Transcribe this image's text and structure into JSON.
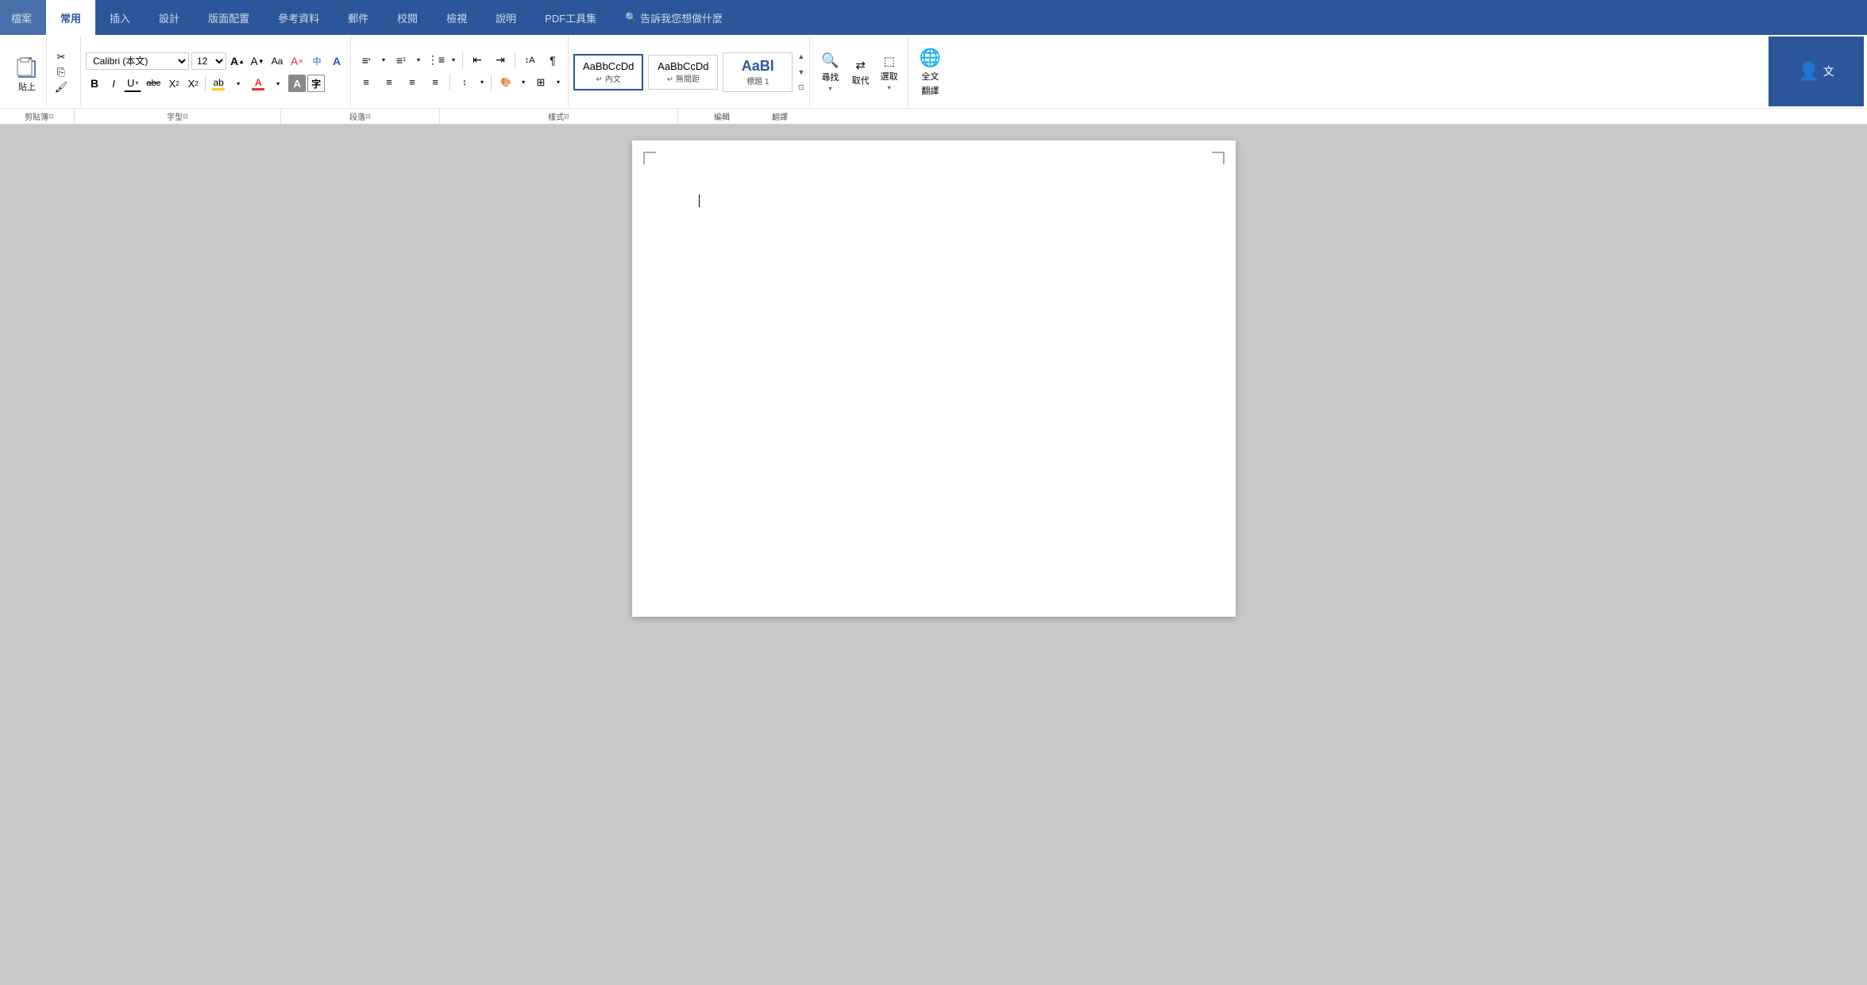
{
  "tabs": [
    {
      "id": "file",
      "label": "檔案",
      "active": false
    },
    {
      "id": "home",
      "label": "常用",
      "active": true
    },
    {
      "id": "insert",
      "label": "插入",
      "active": false
    },
    {
      "id": "design",
      "label": "設計",
      "active": false
    },
    {
      "id": "layout",
      "label": "版面配置",
      "active": false
    },
    {
      "id": "references",
      "label": "參考資料",
      "active": false
    },
    {
      "id": "mailings",
      "label": "郵件",
      "active": false
    },
    {
      "id": "review",
      "label": "校閱",
      "active": false
    },
    {
      "id": "view",
      "label": "檢視",
      "active": false
    },
    {
      "id": "help",
      "label": "說明",
      "active": false
    },
    {
      "id": "pdf",
      "label": "PDF工具集",
      "active": false
    },
    {
      "id": "search",
      "label": "告訴我您想做什麼",
      "active": false
    }
  ],
  "clipboard": {
    "paste": "貼上",
    "cut": "剪下",
    "copy": "複製",
    "format_painter": "複製格式",
    "label": "剪貼簿"
  },
  "font": {
    "name": "Calibri (本文)",
    "size": "12",
    "label": "字型",
    "grow": "增大字型",
    "shrink": "縮小字型",
    "clear": "清除格式",
    "phonetic": "注音指南",
    "bold": "B",
    "italic": "I",
    "underline": "U",
    "strikethrough": "abc",
    "subscript": "X₂",
    "superscript": "X²",
    "text_color": "A",
    "highlight": "ab",
    "font_color_label": "A",
    "change_case": "Aa"
  },
  "paragraph": {
    "label": "段落",
    "bullets": "項目符號",
    "numbering": "編號",
    "multilevel": "多層次清單",
    "decrease_indent": "減少縮排",
    "increase_indent": "增加縮排",
    "sort": "排序",
    "show_marks": "顯示/隱藏編輯標記",
    "align_left": "靠左對齊",
    "center": "置中",
    "align_right": "靠右對齊",
    "justify": "左右對齊",
    "line_spacing": "行距",
    "shading": "網底",
    "borders": "框線"
  },
  "styles": {
    "label": "樣式",
    "items": [
      {
        "id": "normal",
        "text": "AaBbCcDd",
        "sublabel": "↵ 內文",
        "active": true
      },
      {
        "id": "no_space",
        "text": "AaBbCcDd",
        "sublabel": "↵ 無間距",
        "active": false
      },
      {
        "id": "heading1",
        "text": "AaBl",
        "sublabel": "標題 1",
        "active": false,
        "large": true
      }
    ]
  },
  "editing": {
    "label": "編輯",
    "find": "尋找",
    "replace": "取代",
    "select": "選取"
  },
  "translate": {
    "label": "翻译",
    "full_text": "全文翻譯"
  },
  "group_labels": [
    {
      "id": "clipboard-label",
      "text": "剪貼簿",
      "has_expand": true
    },
    {
      "id": "font-label",
      "text": "字型",
      "has_expand": true
    },
    {
      "id": "paragraph-label",
      "text": "段落",
      "has_expand": true
    },
    {
      "id": "styles-label",
      "text": "樣式",
      "has_expand": true
    },
    {
      "id": "editing-label",
      "text": "編輯",
      "has_expand": false
    },
    {
      "id": "translate-label",
      "text": "翻譯",
      "has_expand": false
    }
  ],
  "document": {
    "page_corner_marker": "L"
  },
  "colors": {
    "accent": "#2b579a",
    "ribbon_bg": "white",
    "tab_bar_bg": "#2b579a",
    "active_tab": "white",
    "doc_bg": "#c8c8c8"
  }
}
